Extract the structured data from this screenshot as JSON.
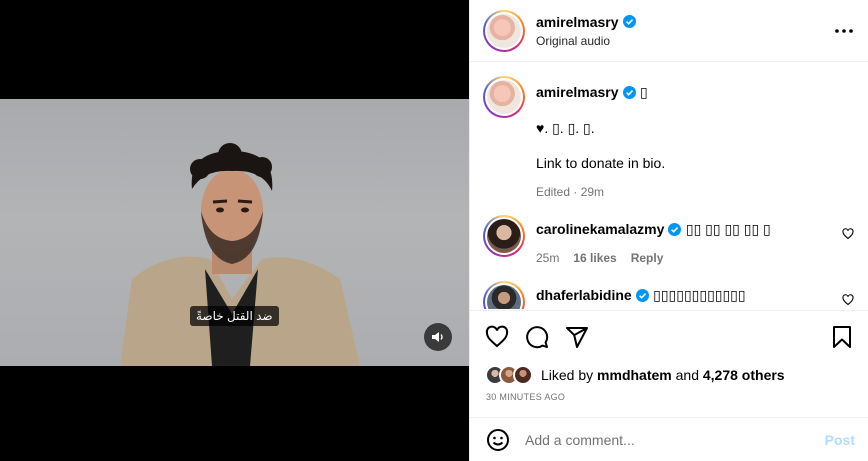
{
  "video": {
    "subtitle": "ضد القتل خاصةً",
    "mute_icon": "speaker-icon"
  },
  "post": {
    "author": "amirelmasry",
    "audio": "Original audio",
    "more_icon": "more-horizontal-icon"
  },
  "caption": {
    "author": "amirelmasry",
    "title_glyph": "▯",
    "line1": "♥. ▯. ▯. ▯.",
    "line2": "Link to donate in bio.",
    "meta": "Edited · 29m"
  },
  "comments": [
    {
      "author": "carolinekamalazmy",
      "text": "▯▯ ▯▯ ▯▯ ▯▯ ▯",
      "time": "25m",
      "likes": "16 likes",
      "reply": "Reply"
    },
    {
      "author": "dhaferlabidine",
      "text": "▯▯▯▯▯▯▯▯▯▯▯▯"
    }
  ],
  "likes": {
    "prefix": "Liked by",
    "user": "mmdhatem",
    "and": "and",
    "count": "4,278 others"
  },
  "timestamp": "30 MINUTES AGO",
  "add_comment": {
    "placeholder": "Add a comment...",
    "post_label": "Post"
  },
  "colors": {
    "verified": "#0095f6",
    "post_disabled": "#b3dbff",
    "meta_gray": "#737373"
  }
}
